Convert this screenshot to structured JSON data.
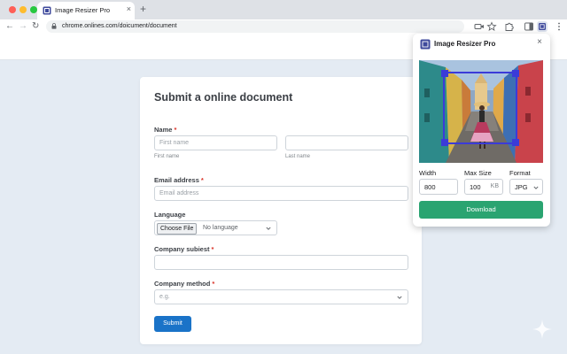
{
  "browser": {
    "tab_title": "Image Resizer Pro",
    "tab_close": "×",
    "new_tab": "+",
    "url": "chrome.onlines.com/doicument/document",
    "nav": {
      "back": "←",
      "forward": "→",
      "reload": "↻"
    },
    "icons": [
      "video-camera-icon",
      "star-icon",
      "puzzle-icon",
      "sidepanel-icon",
      "image-resizer-extension-icon",
      "kebab-menu-icon"
    ]
  },
  "form": {
    "title": "Submit a online document",
    "required_mark": "*",
    "name": {
      "label": "Name",
      "first_placeholder": "First name",
      "first_caption": "First name",
      "last_caption": "Last name"
    },
    "email": {
      "label": "Email address",
      "placeholder": "Email address"
    },
    "language": {
      "label": "Language",
      "button": "Choose File",
      "value": "No language"
    },
    "company_subject": {
      "label": "Company subiest"
    },
    "company_method": {
      "label": "Company method",
      "placeholder": "e.g."
    },
    "submit": "Submit"
  },
  "popup": {
    "title": "Image Resizer Pro",
    "close": "×",
    "width_label": "Width",
    "width_value": "800",
    "max_size_label": "Max Size",
    "max_size_value": "100",
    "max_size_unit": "KB",
    "format_label": "Format",
    "format_value": "JPG",
    "download": "Download"
  },
  "colors": {
    "accent_blue": "#1a73c8",
    "download_green": "#2aa471",
    "crop_frame": "#3b3bd8",
    "page_background": "#e4ebf3"
  }
}
